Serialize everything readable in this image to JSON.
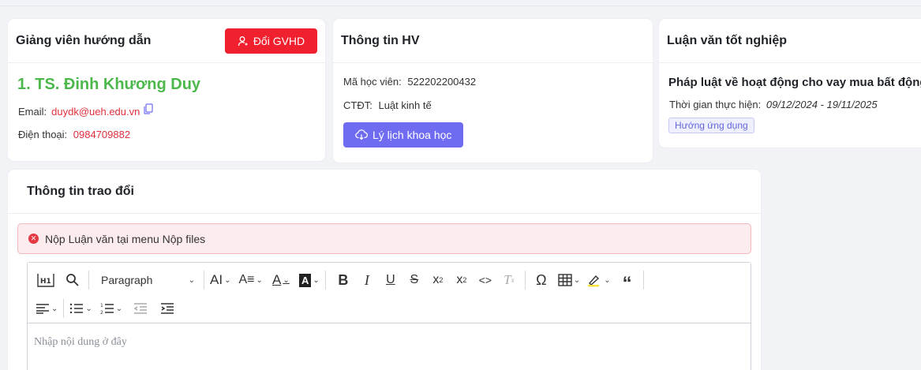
{
  "advisor": {
    "title": "Giảng viên hướng dẫn",
    "change_button": "Đổi GVHD",
    "name": "1. TS. Đinh Khương Duy",
    "email_label": "Email:",
    "email": "duydk@ueh.edu.vn",
    "phone_label": "Điện thoại:",
    "phone": "0984709882"
  },
  "student": {
    "title": "Thông tin HV",
    "id_label": "Mã học viên:",
    "id": "522202200432",
    "program_label": "CTĐT:",
    "program": "Luật kinh tế",
    "cv_button": "Lý lịch khoa học"
  },
  "thesis": {
    "title": "Luận văn tốt nghiệp",
    "name": "Pháp luật về hoạt động cho vay mua bất động",
    "time_label": "Thời gian thực hiện:",
    "time": "09/12/2024 - 19/11/2025",
    "tag": "Hướng ứng dụng"
  },
  "exchange": {
    "title": "Thông tin trao đổi",
    "alert": "Nộp Luận văn tại menu Nộp files",
    "editor": {
      "paragraph_select": "Paragraph",
      "placeholder": "Nhập nội dung ở đây"
    }
  },
  "colors": {
    "danger": "#f0202e",
    "primary": "#6f6cf2",
    "advisor_name": "#4cb84c"
  }
}
